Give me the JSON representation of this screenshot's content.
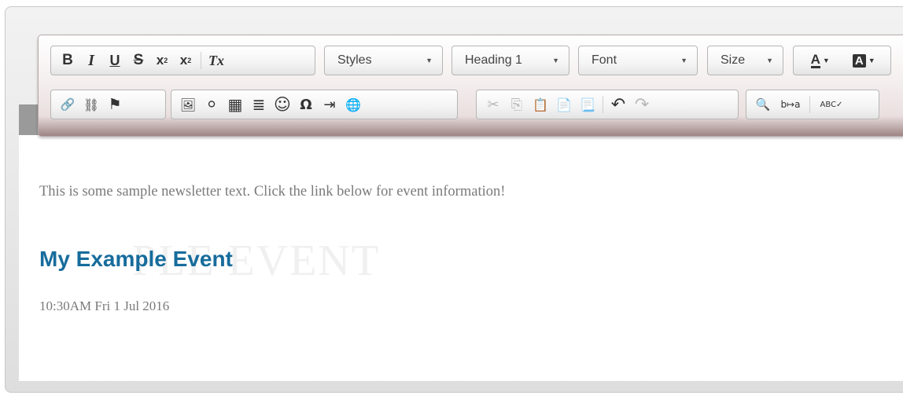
{
  "toolbar": {
    "row1": {
      "basicstyles": [
        "B",
        "I",
        "U",
        "S"
      ],
      "subscript_label": "x",
      "subscript_mark": "2",
      "superscript_label": "x",
      "superscript_mark": "2",
      "remove_format": "Tx",
      "styles_label": "Styles",
      "format_label": "Heading 1",
      "font_label": "Font",
      "size_label": "Size",
      "text_color_label": "A",
      "bg_color_label": "A"
    },
    "icons": {
      "link": "🔗",
      "unlink": "⛓",
      "anchor": "⚑",
      "image": "🖼",
      "flash": "⚪",
      "table": "▦",
      "hr": "≣",
      "smiley": "☺",
      "special_char": "Ω",
      "pagebreak": "⇥",
      "iframe": "🌐",
      "cut": "✂",
      "copy": "⎘",
      "paste": "📋",
      "paste_text": "📄",
      "paste_word": "📃",
      "undo": "↶",
      "redo": "↷",
      "find": "🔍",
      "replace": "b↦a",
      "spellcheck": "ABC✓"
    }
  },
  "content": {
    "paragraph": "This is some sample newsletter text.  Click the link below for event information!",
    "ghost_text": "PLE EVENT",
    "event_title": "My Example Event",
    "event_datetime": "10:30AM Fri 1 Jul 2016"
  },
  "colors": {
    "link": "#176c9c",
    "body_text": "#7a7a7a",
    "toolbar_bottom": "#9e8484"
  }
}
